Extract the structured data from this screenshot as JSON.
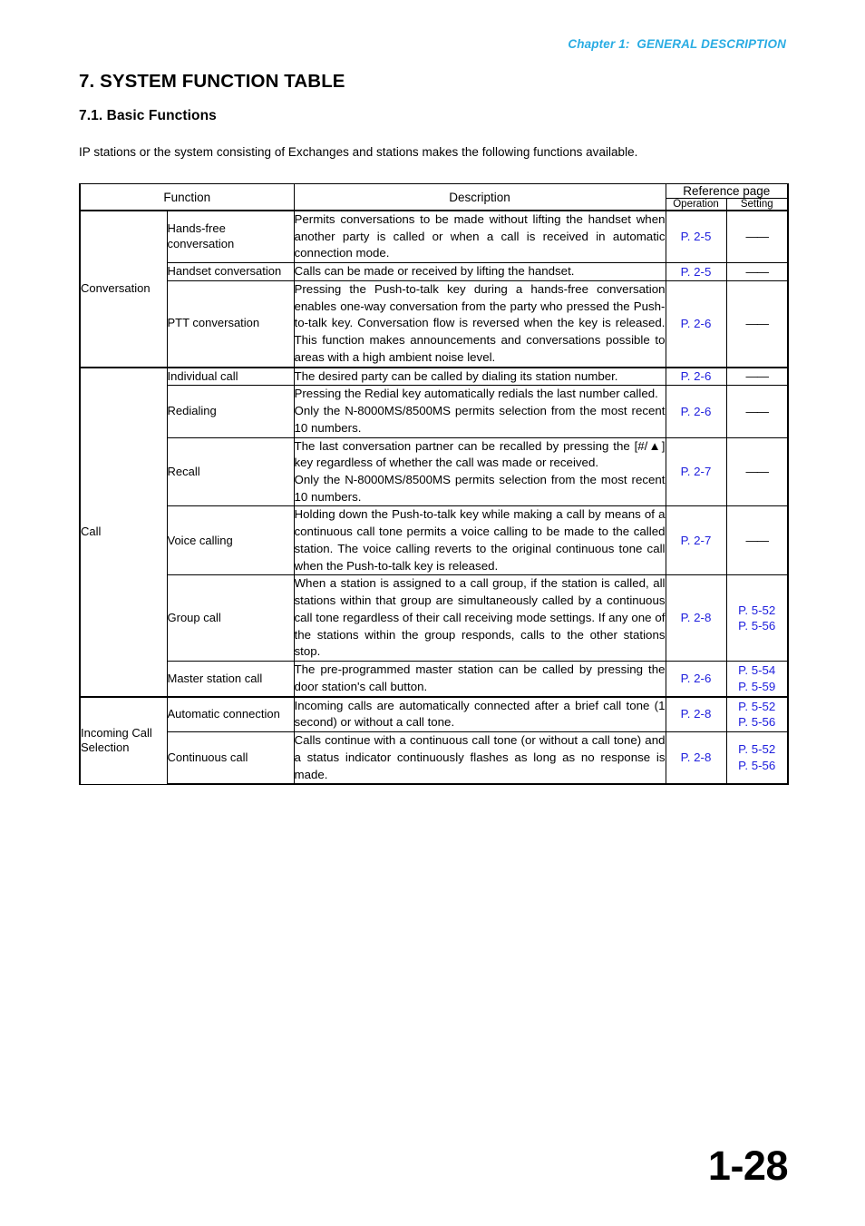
{
  "header": {
    "chapter_label": "Chapter 1:  GENERAL DESCRIPTION"
  },
  "headings": {
    "section_title": "7. SYSTEM FUNCTION TABLE",
    "subsection_title": "7.1. Basic Functions"
  },
  "intro_paragraph": "IP stations or the system consisting of Exchanges and stations makes the following functions available.",
  "table": {
    "headers": {
      "function": "Function",
      "description": "Description",
      "reference_page": "Reference page",
      "operation": "Operation",
      "setting": "Setting"
    },
    "groups": [
      {
        "category": "Conversation",
        "rows": [
          {
            "function": "Hands-free conversation",
            "description": "Permits conversations to be made without lifting the handset when another party is called or when a call is received in automatic connection mode.",
            "operation": "P. 2-5",
            "setting": "——"
          },
          {
            "function": "Handset conversation",
            "description": "Calls can be made or received by lifting the handset.",
            "operation": "P. 2-5",
            "setting": "——"
          },
          {
            "function": "PTT conversation",
            "description": "Pressing the Push-to-talk key during a hands-free conversation enables one-way conversation from the party who pressed the Push-to-talk key. Conversation flow is reversed when the key is released. This function makes announcements and conversations possible to areas with a high ambient noise level.",
            "operation": "P. 2-6",
            "setting": "——"
          }
        ]
      },
      {
        "category": "Call",
        "rows": [
          {
            "function": "Individual call",
            "description": "The desired party can be called by dialing its station number.",
            "operation": "P. 2-6",
            "setting": "——"
          },
          {
            "function": "Redialing",
            "description": "Pressing the Redial key automatically redials the last number called.\nOnly the N-8000MS/8500MS permits selection from the most recent 10 numbers.",
            "operation": "P. 2-6",
            "setting": "——"
          },
          {
            "function": "Recall",
            "description": "The last conversation partner can be recalled by pressing the [#/▲] key regardless of whether the call was made or received.\nOnly the N-8000MS/8500MS permits selection from the most recent 10 numbers.",
            "operation": "P. 2-7",
            "setting": "——"
          },
          {
            "function": "Voice calling",
            "description": "Holding down the Push-to-talk key while making a call by means of a continuous call tone permits a voice calling to be made to the called station. The voice calling reverts to the original continuous tone call when the Push-to-talk key is released.",
            "operation": "P. 2-7",
            "setting": "——"
          },
          {
            "function": "Group call",
            "description": "When a station is assigned to a call group, if the station is called, all stations within that group are simultaneously called by a continuous call tone regardless of their call receiving mode settings. If any one of the stations within the group responds, calls to the other stations stop.",
            "operation": "P. 2-8",
            "setting": "P. 5-52\nP. 5-56"
          },
          {
            "function": "Master station call",
            "description": "The pre-programmed master station can be called by pressing the door station's call button.",
            "operation": "P. 2-6",
            "setting": "P. 5-54\nP. 5-59"
          }
        ]
      },
      {
        "category": "Incoming Call Selection",
        "rows": [
          {
            "function": "Automatic connection",
            "description": "Incoming calls are automatically connected after a brief call tone (1 second) or without a call tone.",
            "operation": "P. 2-8",
            "setting": "P. 5-52\nP. 5-56"
          },
          {
            "function": "Continuous call",
            "description": "Calls continue with a continuous call tone (or without a call tone) and a status indicator continuously flashes as long as no response is made.",
            "operation": "P. 2-8",
            "setting": "P. 5-52\nP. 5-56"
          }
        ]
      }
    ]
  },
  "footer": {
    "page_number": "1-28"
  },
  "colors": {
    "chapter_header": "#29ace3",
    "reference_link": "#2020dd",
    "text": "#000000",
    "background": "#ffffff"
  }
}
